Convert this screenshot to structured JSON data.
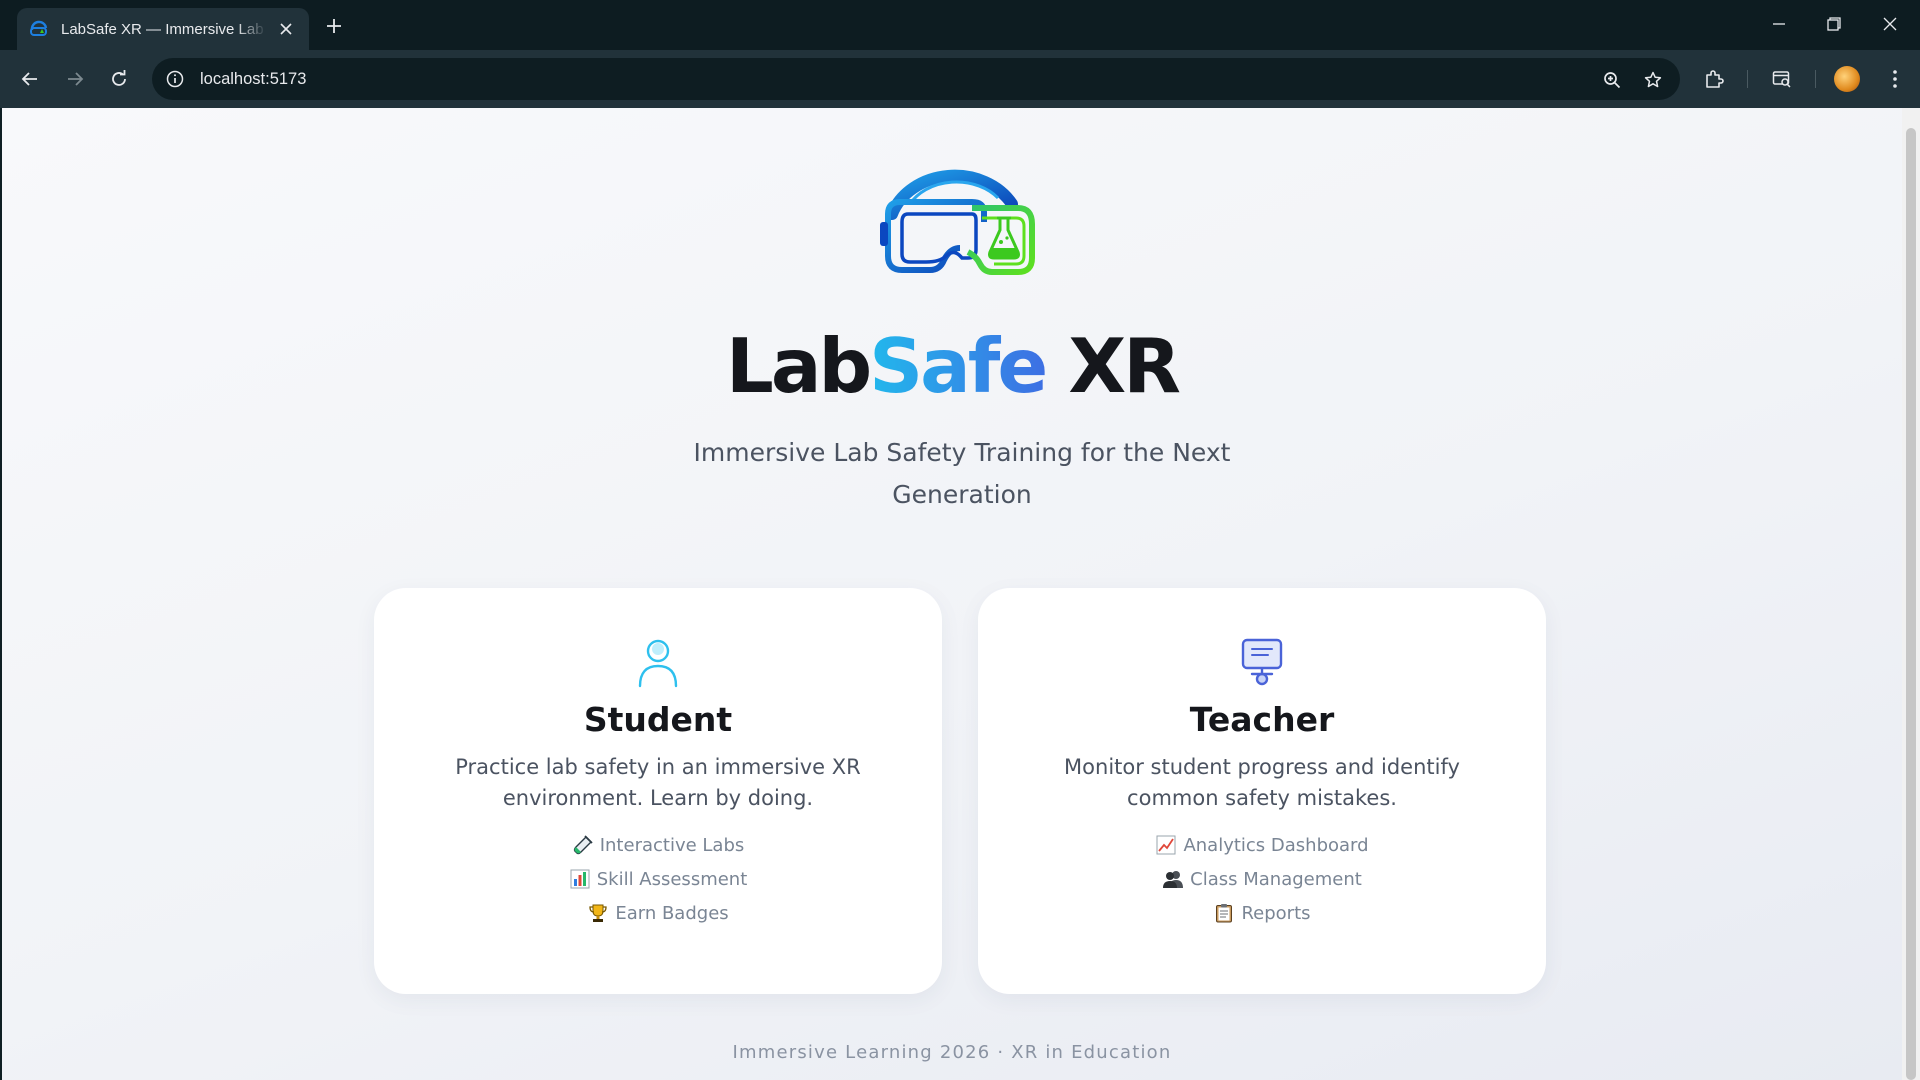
{
  "browser": {
    "tab_title": "LabSafe XR — Immersive Lab Safety Training",
    "url": "localhost:5173"
  },
  "hero": {
    "brand_lab": "Lab",
    "brand_safe": "Safe",
    "brand_xr": " XR",
    "tagline": "Immersive Lab Safety Training for the Next Generation"
  },
  "roles": [
    {
      "title": "Student",
      "description": "Practice lab safety in an immersive XR environment. Learn by doing.",
      "features": [
        {
          "icon": "test-tube-icon",
          "label": "Interactive Labs"
        },
        {
          "icon": "bar-chart-icon",
          "label": "Skill Assessment"
        },
        {
          "icon": "trophy-icon",
          "label": "Earn Badges"
        }
      ]
    },
    {
      "title": "Teacher",
      "description": "Monitor student progress and identify common safety mistakes.",
      "features": [
        {
          "icon": "line-chart-icon",
          "label": "Analytics Dashboard"
        },
        {
          "icon": "users-icon",
          "label": "Class Management"
        },
        {
          "icon": "clipboard-icon",
          "label": "Reports"
        }
      ]
    }
  ],
  "footer": {
    "text": "Immersive Learning 2026 · XR in Education"
  },
  "colors": {
    "accent_start": "#22b8ec",
    "accent_end": "#3d6fe3",
    "logo_green": "#3cc91f",
    "student_icon": "#2ec0ee",
    "teacher_icon": "#4a63d8"
  }
}
